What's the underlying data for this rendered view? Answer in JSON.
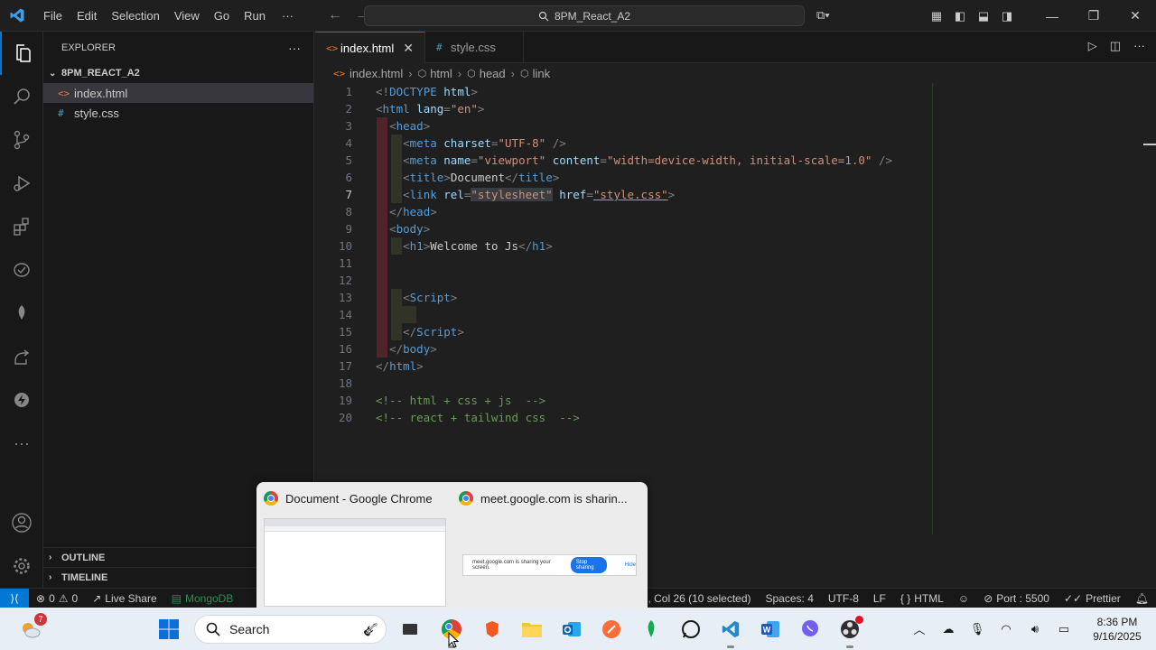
{
  "titlebar": {
    "menus": [
      "File",
      "Edit",
      "Selection",
      "View",
      "Go",
      "Run"
    ],
    "more": "···",
    "search_text": "8PM_React_A2"
  },
  "sidebar": {
    "header": "EXPLORER",
    "more": "···",
    "folder": "8PM_REACT_A2",
    "files": [
      {
        "name": "index.html",
        "icon": "<>"
      },
      {
        "name": "style.css",
        "icon": "#"
      }
    ],
    "outline": "OUTLINE",
    "timeline": "TIMELINE"
  },
  "tabs": [
    {
      "label": "index.html",
      "icon": "<>",
      "close": "✕"
    },
    {
      "label": "style.css",
      "icon": "#"
    }
  ],
  "breadcrumb": [
    "index.html",
    "html",
    "head",
    "link"
  ],
  "editor": {
    "current_line": 7,
    "lines": [
      {
        "n": "1"
      },
      {
        "n": "2"
      },
      {
        "n": "3"
      },
      {
        "n": "4"
      },
      {
        "n": "5"
      },
      {
        "n": "6"
      },
      {
        "n": "7"
      },
      {
        "n": "8"
      },
      {
        "n": "9"
      },
      {
        "n": "10"
      },
      {
        "n": "11"
      },
      {
        "n": "12"
      },
      {
        "n": "13"
      },
      {
        "n": "14"
      },
      {
        "n": "15"
      },
      {
        "n": "16"
      },
      {
        "n": "17"
      },
      {
        "n": "18"
      },
      {
        "n": "19"
      },
      {
        "n": "20"
      }
    ],
    "code": {
      "l1_a": "<!",
      "l1_b": "DOCTYPE",
      "l1_c": "html",
      "l1_d": ">",
      "l2_a": "<",
      "l2_b": "html",
      "l2_c": "lang",
      "l2_d": "=",
      "l2_e": "\"en\"",
      "l2_f": ">",
      "l3_a": "<",
      "l3_b": "head",
      "l3_c": ">",
      "l4_a": "<",
      "l4_b": "meta",
      "l4_c": "charset",
      "l4_d": "=",
      "l4_e": "\"UTF-8\"",
      "l4_f": " />",
      "l5_a": "<",
      "l5_b": "meta",
      "l5_c": "name",
      "l5_d": "=",
      "l5_e": "\"viewport\"",
      "l5_f": "content",
      "l5_g": "=",
      "l5_h": "\"width=device-width, initial-scale=1.0\"",
      "l5_i": " />",
      "l6_a": "<",
      "l6_b": "title",
      "l6_c": ">",
      "l6_d": "Document",
      "l6_e": "</",
      "l6_f": "title",
      "l6_g": ">",
      "l7_a": "<",
      "l7_b": "link",
      "l7_c": "rel",
      "l7_d": "=",
      "l7_e": "\"stylesheet\"",
      "l7_f": "href",
      "l7_g": "=",
      "l7_h": "\"style.css\"",
      "l7_i": ">",
      "l8_a": "</",
      "l8_b": "head",
      "l8_c": ">",
      "l9_a": "<",
      "l9_b": "body",
      "l9_c": ">",
      "l10_a": "<",
      "l10_b": "h1",
      "l10_c": ">",
      "l10_d": "Welcome to Js",
      "l10_e": "</",
      "l10_f": "h1",
      "l10_g": ">",
      "l13_a": "<",
      "l13_b": "Script",
      "l13_c": ">",
      "l15_a": "</",
      "l15_b": "Script",
      "l15_c": ">",
      "l16_a": "</",
      "l16_b": "body",
      "l16_c": ">",
      "l17_a": "</",
      "l17_b": "html",
      "l17_c": ">",
      "l19": "<!-- html + css + js  -->",
      "l20": "<!-- react + tailwind css  -->"
    }
  },
  "statusbar": {
    "errors": "0",
    "warnings": "0",
    "live_share": "Live Share",
    "mongodb": "MongoDB",
    "cursor": "7, Col 26 (10 selected)",
    "spaces": "Spaces: 4",
    "encoding": "UTF-8",
    "eol": "LF",
    "language": "HTML",
    "port": "Port : 5500",
    "prettier": "Prettier"
  },
  "popup": {
    "card1_title": "Document - Google Chrome",
    "card2_title": "meet.google.com is sharin...",
    "thumb2_text": "meet.google.com is sharing your screen.",
    "stop_label": "Stop sharing",
    "hide_label": "Hide"
  },
  "taskbar": {
    "search_label": "Search",
    "badge_count": "7",
    "time": "8:36 PM",
    "date": "9/16/2025"
  },
  "colors": {
    "accent": "#0078d4",
    "tag": "#569cd6",
    "attr_name": "#9cdcfe",
    "attr_value": "#ce9178",
    "comment": "#6a9955"
  }
}
